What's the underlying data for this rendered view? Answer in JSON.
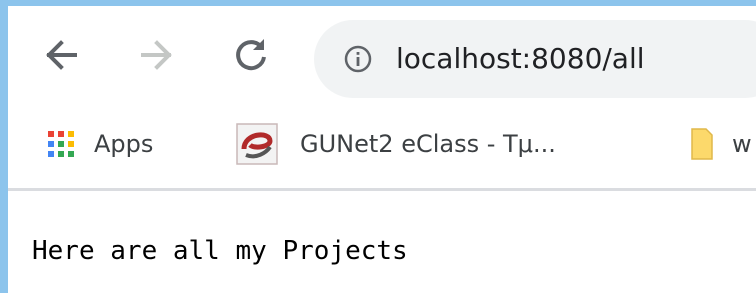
{
  "browser": {
    "address_bar": {
      "url": "localhost:8080/all",
      "info_icon": "info-circle-icon"
    },
    "nav_icons": {
      "back": "arrow-left-icon",
      "forward": "arrow-right-icon",
      "reload": "reload-icon"
    },
    "bookmarks": [
      {
        "label": "Apps",
        "icon": "apps-grid-icon"
      },
      {
        "label": "GUNet2 eClass - Τμ...",
        "icon": "eclass-logo-icon"
      },
      {
        "label": "w",
        "icon": "folder-icon"
      }
    ]
  },
  "page": {
    "text": "Here are all my Projects"
  },
  "colors": {
    "frame": "#8cc4ec",
    "omnibox_bg": "#f1f3f4",
    "icon_active": "#5f6368",
    "icon_disabled": "#c4c7c5",
    "folder": "#fcd96b"
  }
}
